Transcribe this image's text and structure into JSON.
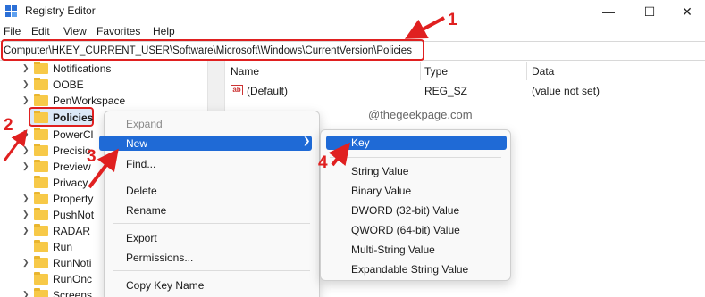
{
  "window": {
    "title": "Registry Editor",
    "controls": {
      "minimize": "—",
      "maximize": "☐",
      "close": "✕"
    }
  },
  "menubar": [
    "File",
    "Edit",
    "View",
    "Favorites",
    "Help"
  ],
  "address": "Computer\\HKEY_CURRENT_USER\\Software\\Microsoft\\Windows\\CurrentVersion\\Policies",
  "tree": [
    "Notifications",
    "OOBE",
    "PenWorkspace",
    "Policies",
    "PowerCl",
    "Precisio",
    "Preview",
    "Privacy",
    "Property",
    "PushNot",
    "RADAR",
    "Run",
    "RunNoti",
    "RunOnc",
    "Screens"
  ],
  "list": {
    "headers": {
      "name": "Name",
      "type": "Type",
      "data": "Data"
    },
    "row": {
      "name": "(Default)",
      "type": "REG_SZ",
      "data": "(value not set)"
    }
  },
  "watermark": "@thegeekpage.com",
  "context_menu": {
    "items": [
      "Expand",
      "New",
      "Find...",
      "Delete",
      "Rename",
      "Export",
      "Permissions...",
      "Copy Key Name"
    ]
  },
  "submenu": {
    "items": [
      "Key",
      "String Value",
      "Binary Value",
      "DWORD (32-bit) Value",
      "QWORD (64-bit) Value",
      "Multi-String Value",
      "Expandable String Value"
    ]
  },
  "annotations": [
    "1",
    "2",
    "3",
    "4"
  ],
  "colors": {
    "highlight": "#e02020",
    "menu_selection": "#1f6ad6",
    "folder": "#f7c948"
  }
}
